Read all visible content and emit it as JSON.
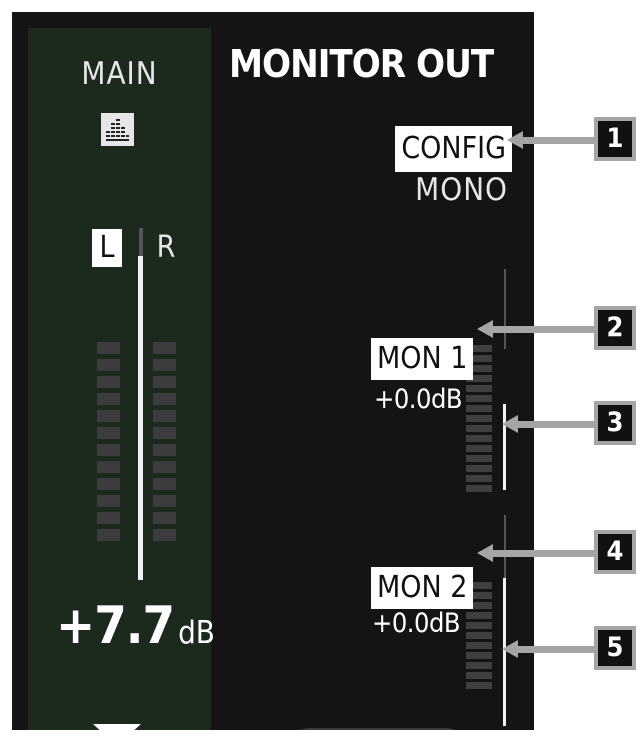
{
  "main": {
    "label": "MAIN",
    "icon": "stack-icon",
    "left_channel": "L",
    "right_channel": "R",
    "level_value": "+7.7",
    "level_unit": "dB",
    "meter_segments": 12
  },
  "header": {
    "title": "MONITOR OUT"
  },
  "config": {
    "label": "CONFIG",
    "value": "MONO"
  },
  "mon1": {
    "label": "MON 1",
    "level": "+0.0dB"
  },
  "mon2": {
    "label": "MON 2",
    "level": "+0.0dB"
  },
  "pager": {
    "count": 5,
    "active_index": 2
  },
  "callouts": [
    "1",
    "2",
    "3",
    "4",
    "5"
  ],
  "colors": {
    "main_bg": "#1c2a1d",
    "screen_bg": "#141414",
    "callout": "#a5a5a5"
  }
}
